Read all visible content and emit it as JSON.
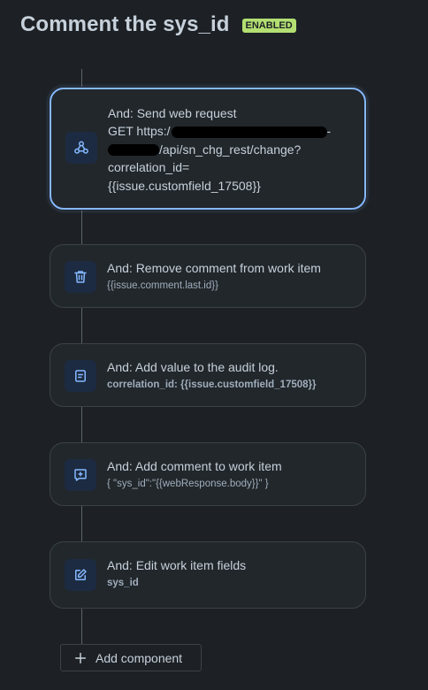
{
  "header": {
    "title": "Comment the sys_id",
    "badge": "ENABLED"
  },
  "components": [
    {
      "icon": "webhook-icon",
      "title": "And: Send web request",
      "lines": [
        "GET https:/",
        "-",
        "/api/sn_chg_rest/change?",
        "correlation_id=",
        "{{issue.customfield_17508}}"
      ]
    },
    {
      "icon": "trash-icon",
      "title": "And: Remove comment from work item",
      "subtitle": "{{issue.comment.last.id}}"
    },
    {
      "icon": "audit-log-icon",
      "title": "And: Add value to the audit log.",
      "subtitle": "correlation_id: {{issue.customfield_17508}}"
    },
    {
      "icon": "add-comment-icon",
      "title": "And: Add comment to work item",
      "subtitle": "{ \"sys_id\":\"{{webResponse.body}}\" }"
    },
    {
      "icon": "edit-icon",
      "title": "And: Edit work item fields",
      "subtitle": "sys_id"
    }
  ],
  "add_component": {
    "icon": "plus-icon",
    "label": "Add component"
  },
  "colors": {
    "background": "#1d2125",
    "card": "#22272b",
    "selected_border": "#85b8ff",
    "badge": "#b3df72",
    "icon": "#85b8ff"
  }
}
